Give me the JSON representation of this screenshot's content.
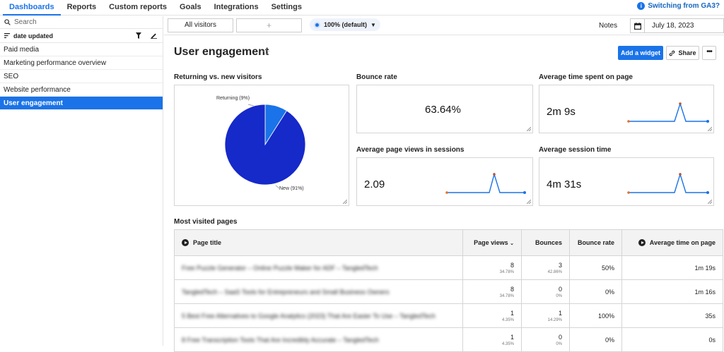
{
  "nav": {
    "items": [
      "Dashboards",
      "Reports",
      "Custom reports",
      "Goals",
      "Integrations",
      "Settings"
    ],
    "switch_label": "Switching from GA3?"
  },
  "sidebar": {
    "search_placeholder": "Search",
    "sort_label": "date updated",
    "items": [
      "Paid media",
      "Marketing performance overview",
      "SEO",
      "Website performance",
      "User engagement"
    ]
  },
  "toolbar": {
    "segment": "All visitors",
    "add_segment": "+",
    "sampling": "100% (default)",
    "notes": "Notes",
    "date": "July 18, 2023"
  },
  "header": {
    "title": "User engagement",
    "add_widget": "Add a widget",
    "share": "Share",
    "more": "•••"
  },
  "widgets": {
    "returning": {
      "label": "Returning vs. new visitors",
      "slices": [
        {
          "name": "Returning (9%)",
          "value": 9,
          "color": "#1a73e8"
        },
        {
          "name": "New (91%)",
          "value": 91,
          "color": "#1629c9"
        }
      ]
    },
    "bounce": {
      "label": "Bounce rate",
      "value": "63.64%"
    },
    "avg_time_page": {
      "label": "Average time spent on page",
      "value": "2m 9s"
    },
    "avg_views": {
      "label": "Average page views in sessions",
      "value": "2.09"
    },
    "avg_session": {
      "label": "Average session time",
      "value": "4m 31s"
    }
  },
  "chart_data": [
    {
      "type": "pie",
      "title": "Returning vs. new visitors",
      "categories": [
        "Returning",
        "New"
      ],
      "values": [
        9,
        91
      ]
    }
  ],
  "table": {
    "label": "Most visited pages",
    "headers": [
      "Page title",
      "Page views",
      "Bounces",
      "Bounce rate",
      "Average time on page"
    ],
    "rows": [
      {
        "title": "Free Puzzle Generator – Online Puzzle Maker for ADF – TangledTech",
        "views": "8",
        "views_pct": "34.78%",
        "bounces": "3",
        "bounces_pct": "42.86%",
        "rate": "50%",
        "time": "1m 19s"
      },
      {
        "title": "TangledTech – SaaS Tools for Entrepreneurs and Small Business Owners",
        "views": "8",
        "views_pct": "34.78%",
        "bounces": "0",
        "bounces_pct": "0%",
        "rate": "0%",
        "time": "1m 16s"
      },
      {
        "title": "5 Best Free Alternatives to Google Analytics (2023) That Are Easier To Use – TangledTech",
        "views": "1",
        "views_pct": "4.35%",
        "bounces": "1",
        "bounces_pct": "14.29%",
        "rate": "100%",
        "time": "35s"
      },
      {
        "title": "8 Free Transcription Tools That Are Incredibly Accurate – TangledTech",
        "views": "1",
        "views_pct": "4.35%",
        "bounces": "0",
        "bounces_pct": "0%",
        "rate": "0%",
        "time": "0s"
      }
    ]
  }
}
